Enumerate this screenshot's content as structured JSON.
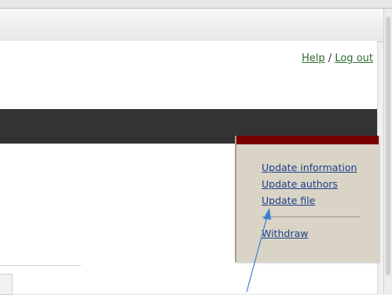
{
  "header": {
    "help_label": "Help",
    "separator": "/",
    "logout_label": "Log out"
  },
  "action_panel": {
    "links": [
      {
        "label": "Update information"
      },
      {
        "label": "Update authors"
      },
      {
        "label": "Update file"
      }
    ],
    "withdraw_label": "Withdraw"
  },
  "colors": {
    "dark_bar": "#333333",
    "panel_header": "#7a0000",
    "panel_bg": "#d9d4c6",
    "link": "#1d3f88",
    "top_link": "#2e6b2e",
    "annotation_arrow": "#3b7fd4"
  }
}
